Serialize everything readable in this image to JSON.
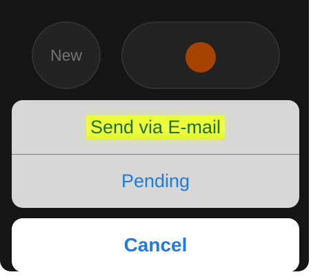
{
  "background_app": {
    "new_button_label": "New"
  },
  "action_sheet": {
    "items": [
      {
        "label": "Send via E-mail"
      },
      {
        "label": "Pending"
      }
    ],
    "cancel_label": "Cancel"
  },
  "colors": {
    "accent": "#1e7be0",
    "record_dot": "#cc5200",
    "highlighter": "#e8ff2e"
  },
  "icons": {
    "record": "record-dot-icon"
  }
}
